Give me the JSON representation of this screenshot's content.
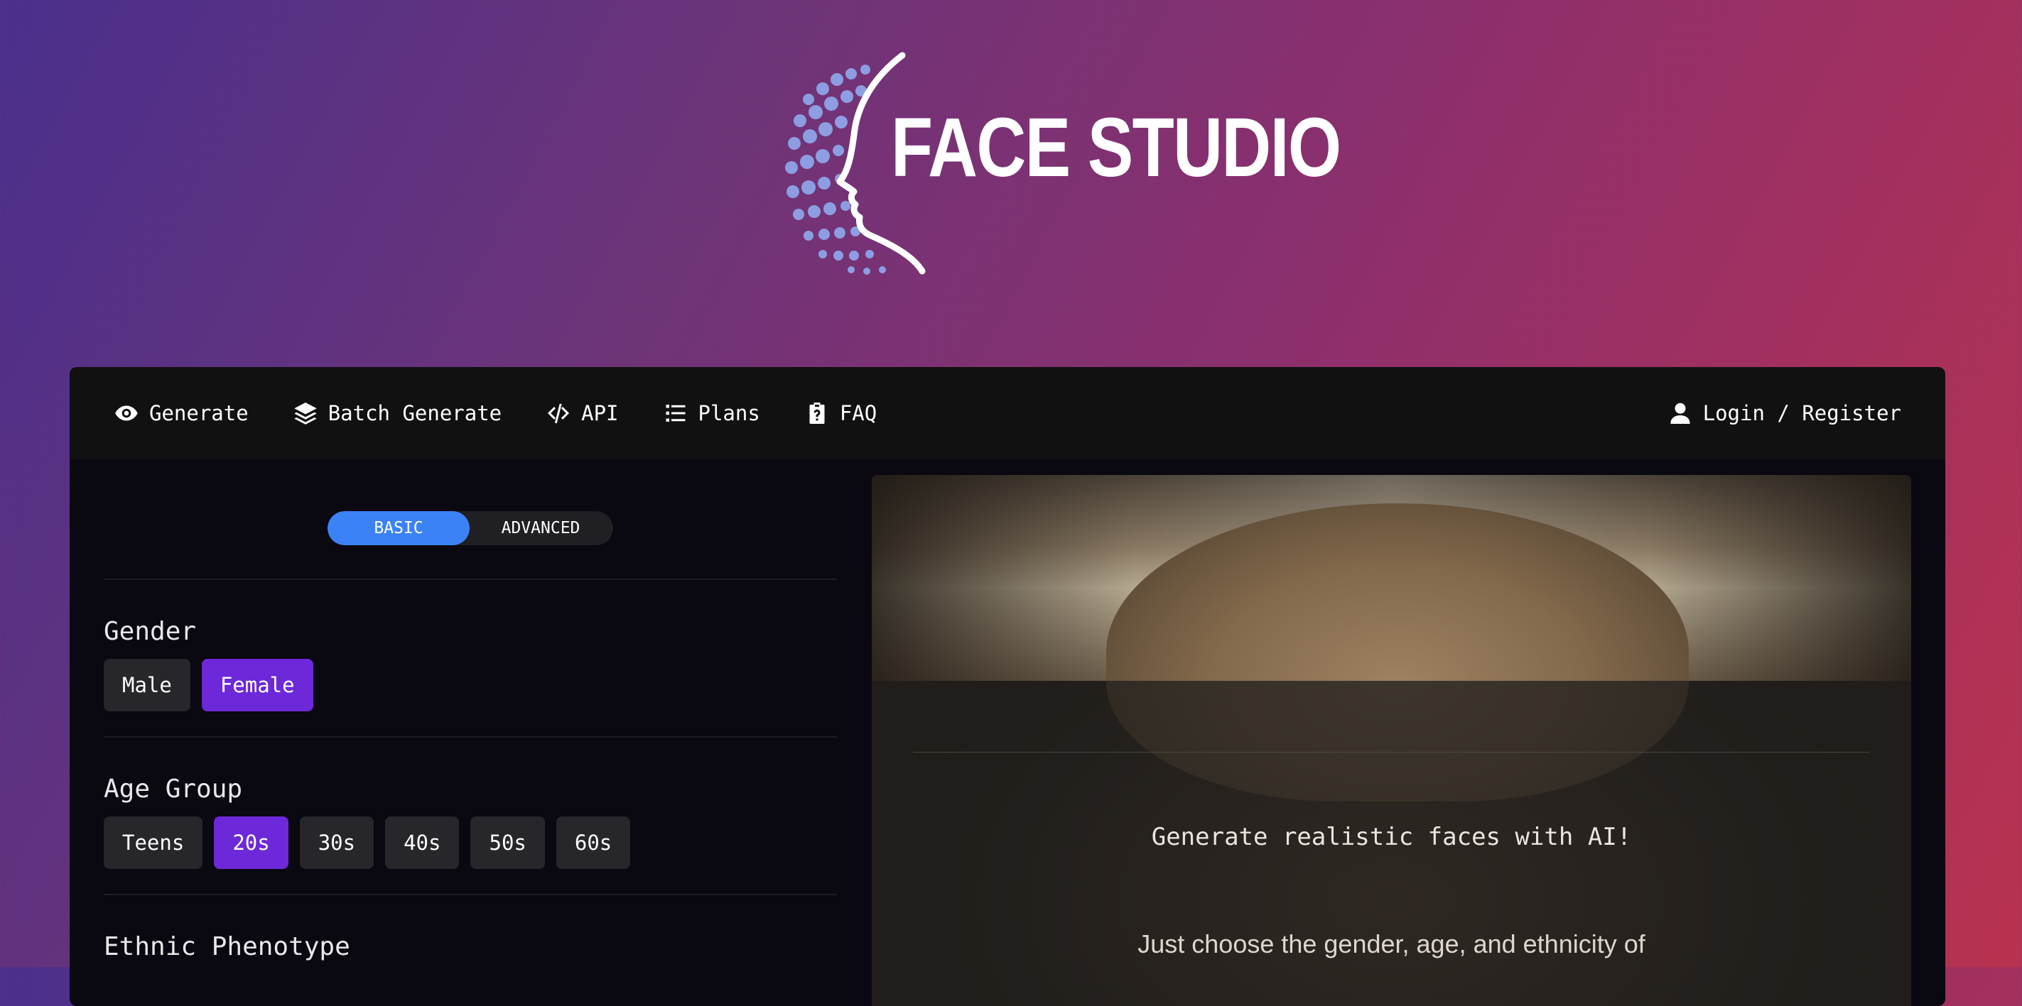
{
  "brand": {
    "name": "FACE STUDIO"
  },
  "nav": {
    "items": [
      {
        "label": "Generate",
        "icon": "eye-icon"
      },
      {
        "label": "Batch Generate",
        "icon": "layers-icon"
      },
      {
        "label": "API",
        "icon": "code-icon"
      },
      {
        "label": "Plans",
        "icon": "list-icon"
      },
      {
        "label": "FAQ",
        "icon": "clipboard-question-icon"
      }
    ],
    "login_label": "Login / Register"
  },
  "mode_toggle": {
    "basic": "BASIC",
    "advanced": "ADVANCED",
    "active": "BASIC"
  },
  "gender": {
    "title": "Gender",
    "options": [
      "Male",
      "Female"
    ],
    "selected": "Female"
  },
  "age_group": {
    "title": "Age Group",
    "options": [
      "Teens",
      "20s",
      "30s",
      "40s",
      "50s",
      "60s"
    ],
    "selected": "20s"
  },
  "ethnic": {
    "title": "Ethnic Phenotype"
  },
  "preview": {
    "headline": "Generate realistic faces with AI!",
    "body": "Just choose the gender, age, and ethnicity of"
  },
  "colors": {
    "accent_blue": "#3b82f6",
    "accent_purple": "#6d28d9",
    "nav_bg": "#111111",
    "panel_bg": "#0a0810"
  }
}
